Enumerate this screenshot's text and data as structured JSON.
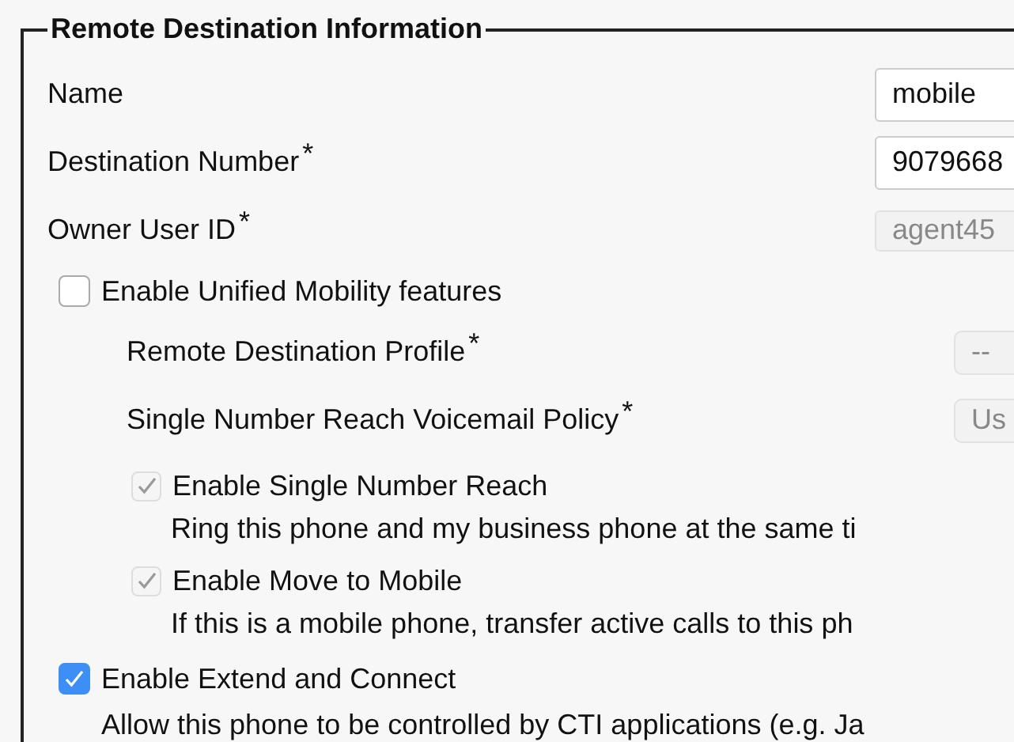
{
  "section": {
    "title": "Remote Destination Information",
    "items": [
      {
        "kind": "text_field",
        "label": "Name",
        "value": "mobile",
        "disabled": false
      },
      {
        "kind": "text_field",
        "label": "Destination Number",
        "required_mark": "*",
        "value": "9079668",
        "disabled": false
      },
      {
        "kind": "text_field",
        "label": "Owner User ID",
        "required_mark": "*",
        "value": "agent45",
        "disabled": true
      },
      {
        "kind": "checkbox",
        "label": "Enable Unified Mobility features",
        "checked": false,
        "disabled": false,
        "children": [
          {
            "kind": "dropdown",
            "label": "Remote Destination Profile",
            "required_mark": "*",
            "value": "--",
            "disabled": true
          },
          {
            "kind": "dropdown",
            "label": "Single Number Reach Voicemail Policy",
            "required_mark": "*",
            "value": "Us",
            "disabled": true
          },
          {
            "kind": "checkbox",
            "label": "Enable Single Number Reach",
            "checked": true,
            "disabled": true,
            "description": "Ring this phone and my business phone at the same ti"
          },
          {
            "kind": "checkbox",
            "label": "Enable Move to Mobile",
            "checked": true,
            "disabled": true,
            "description": "If this is a mobile phone, transfer active calls to this ph"
          }
        ]
      },
      {
        "kind": "checkbox",
        "label": "Enable Extend and Connect",
        "checked": true,
        "disabled": false,
        "description": "Allow this phone to be controlled by CTI applications (e.g. Ja"
      }
    ]
  }
}
